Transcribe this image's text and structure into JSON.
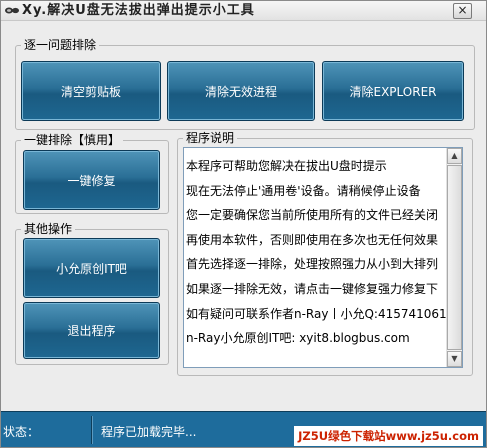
{
  "window": {
    "title": "Xy.解决U盘无法拔出弹出提示小工具",
    "close_label": "×"
  },
  "groups": {
    "troubleshoot": {
      "label": "逐一问题排除",
      "buttons": [
        "清空剪贴板",
        "清除无效进程",
        "清除EXPLORER"
      ]
    },
    "one_click": {
      "label": "一键排除【慎用】",
      "button": "一键修复"
    },
    "other": {
      "label": "其他操作",
      "buttons": [
        "小允原创IT吧",
        "退出程序"
      ]
    },
    "notes": {
      "label": "程序说明",
      "lines": [
        "本程序可帮助您解决在拔出U盘时提示",
        "现在无法停止'通用卷'设备。请稍候停止设备",
        "您一定要确保您当前所使用所有的文件已经关闭",
        "再使用本软件，否则即使用在多次也无任何效果",
        "首先选择逐一排除，处理按照强力从小到大排列",
        "如果逐一排除无效，请点击一键修复强力修复下",
        "如有疑问可联系作者n-Ray丨小允Q:415741061",
        "n-Ray小允原创IT吧:   xyit8.blogbus.com"
      ]
    }
  },
  "statusbar": {
    "label": "状态：",
    "text": "程序已加载完毕...",
    "watermark": "JZ5U绿色下载站www.jz5u.com"
  },
  "colors": {
    "button": "#1e6791",
    "statusbar": "#1e6c9c",
    "watermark": "#cc2200"
  }
}
